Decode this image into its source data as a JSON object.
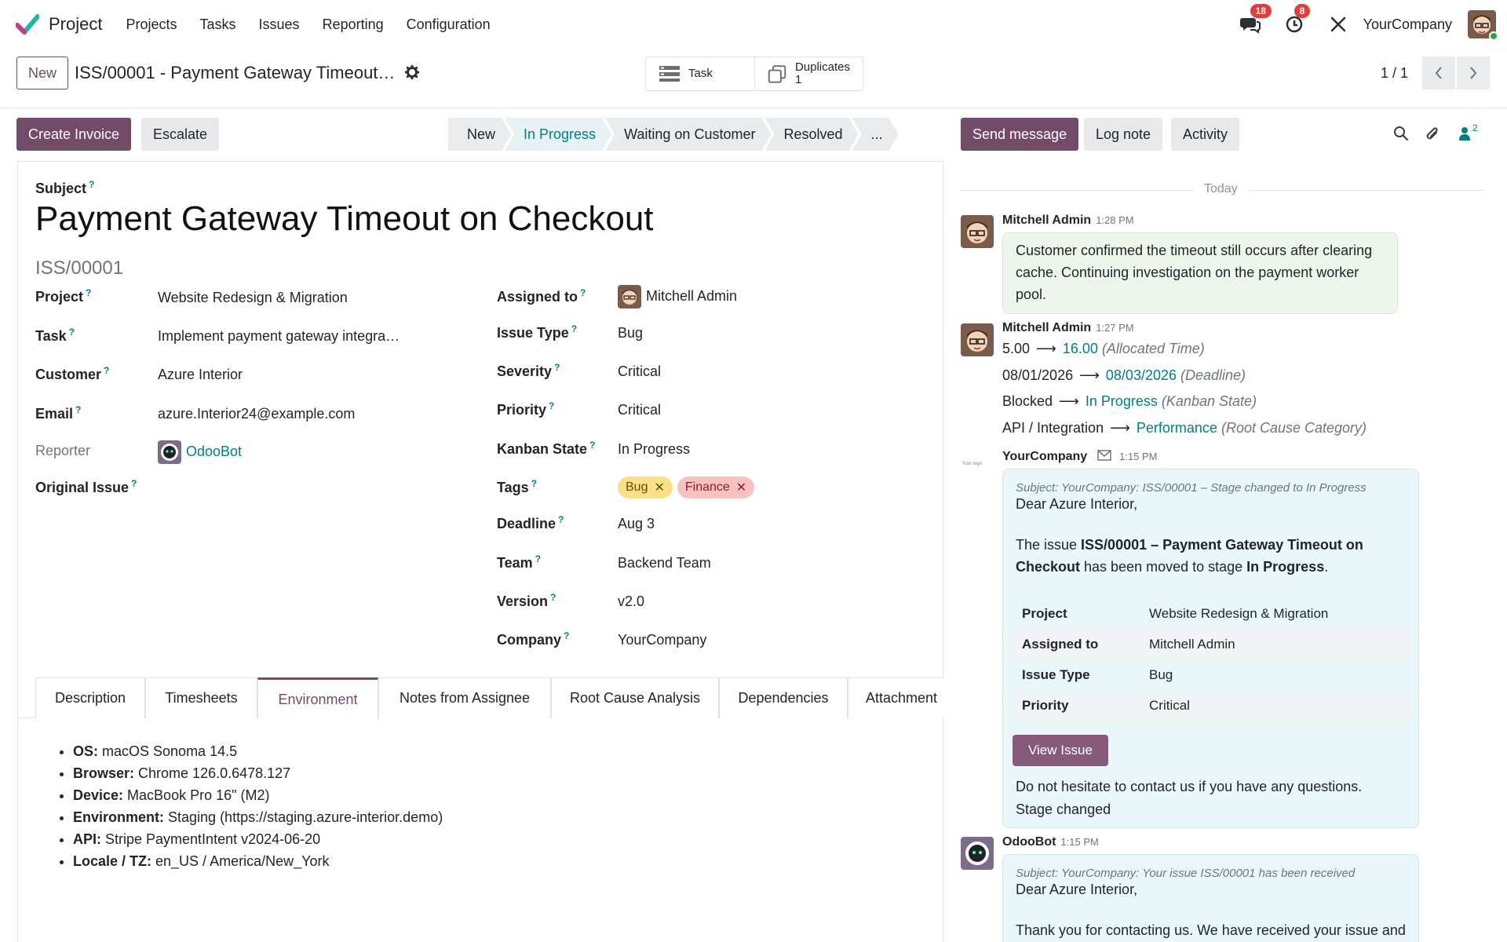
{
  "app": {
    "name": "Project",
    "menu": [
      "Projects",
      "Tasks",
      "Issues",
      "Reporting",
      "Configuration"
    ],
    "company": "YourCompany",
    "messages_count": "18",
    "activities_count": "8"
  },
  "control": {
    "new_label": "New",
    "record_name": "ISS/00001 - Payment Gateway Timeout…",
    "smart_task_label": "Task",
    "smart_duplicates_label": "Duplicates",
    "smart_duplicates_count": "1",
    "pager": "1 / 1"
  },
  "actions": {
    "create_invoice": "Create Invoice",
    "escalate": "Escalate"
  },
  "stages": [
    "New",
    "In Progress",
    "Waiting on Customer",
    "Resolved",
    "..."
  ],
  "active_stage": "In Progress",
  "form": {
    "subject_label": "Subject",
    "title": "Payment Gateway Timeout on Checkout",
    "reference": "ISS/00001",
    "left_fields": [
      {
        "label": "Project",
        "value": "Website Redesign & Migration"
      },
      {
        "label": "Task",
        "value": "Implement payment gateway integra…"
      },
      {
        "label": "Customer",
        "value": "Azure Interior"
      },
      {
        "label": "Email",
        "value": "azure.Interior24@example.com"
      },
      {
        "label": "Reporter",
        "value": "OdooBot"
      },
      {
        "label": "Original Issue",
        "value": ""
      }
    ],
    "right_fields": [
      {
        "label": "Assigned to",
        "value": "Mitchell Admin"
      },
      {
        "label": "Issue Type",
        "value": "Bug"
      },
      {
        "label": "Severity",
        "value": "Critical"
      },
      {
        "label": "Priority",
        "value": "Critical"
      },
      {
        "label": "Kanban State",
        "value": "In Progress"
      },
      {
        "label": "Tags",
        "value": ""
      },
      {
        "label": "Deadline",
        "value": "Aug 3"
      },
      {
        "label": "Team",
        "value": "Backend Team"
      },
      {
        "label": "Version",
        "value": "v2.0"
      },
      {
        "label": "Company",
        "value": "YourCompany"
      }
    ],
    "tags": [
      {
        "name": "Bug",
        "color": "#fbe08a"
      },
      {
        "name": "Finance",
        "color": "#f9c2c2"
      }
    ],
    "help_mark": "?",
    "tag_remove": "✕"
  },
  "tabs": [
    "Description",
    "Timesheets",
    "Environment",
    "Notes from Assignee",
    "Root Cause Analysis",
    "Dependencies",
    "Attachment"
  ],
  "active_tab": "Environment",
  "environment": [
    {
      "key": "OS:",
      "value": " macOS Sonoma 14.5"
    },
    {
      "key": "Browser:",
      "value": " Chrome 126.0.6478.127"
    },
    {
      "key": "Device:",
      "value": " MacBook Pro 16\" (M2)"
    },
    {
      "key": "Environment:",
      "value": " Staging (https://staging.azure-interior.demo)"
    },
    {
      "key": "API:",
      "value": " Stripe PaymentIntent v2024-06-20"
    },
    {
      "key": "Locale / TZ:",
      "value": " en_US / America/New_York"
    }
  ],
  "chatter": {
    "send_message": "Send message",
    "log_note": "Log note",
    "activity": "Activity",
    "followers_count": "2",
    "date_separator": "Today",
    "messages": [
      {
        "author": "Mitchell Admin",
        "time": "1:28 PM",
        "body": "Customer confirmed the timeout still occurs after clearing cache. Continuing investigation on the payment worker pool."
      },
      {
        "author": "Mitchell Admin",
        "time": "1:27 PM",
        "tracking": [
          {
            "old": "5.00",
            "new": "16.00",
            "field": "(Allocated Time)"
          },
          {
            "old": "08/01/2026",
            "new": "08/03/2026",
            "field": "(Deadline)"
          },
          {
            "old": "Blocked",
            "new": "In Progress",
            "field": "(Kanban State)"
          },
          {
            "old": "API / Integration",
            "new": "Performance",
            "field": "(Root Cause Category)"
          }
        ],
        "arrow": "⟶"
      },
      {
        "author": "YourCompany",
        "time": "1:15 PM",
        "logo_text": "Your logo",
        "subject": "Subject: YourCompany: ISS/00001 – Stage changed to In Progress",
        "greeting": "Dear Azure Interior,",
        "body_pre": "The issue ",
        "body_bold": "ISS/00001 – Payment Gateway Timeout on Checkout",
        "body_mid": " has been moved to stage ",
        "body_stage": "In Progress",
        "body_end": ".",
        "table": [
          {
            "k": "Project",
            "v": "Website Redesign & Migration"
          },
          {
            "k": "Assigned to",
            "v": "Mitchell Admin"
          },
          {
            "k": "Issue Type",
            "v": "Bug"
          },
          {
            "k": "Priority",
            "v": "Critical"
          }
        ],
        "button": "View Issue",
        "closing": "Do not hesitate to contact us if you have any questions.",
        "footer": "Stage changed"
      },
      {
        "author": "OdooBot",
        "time": "1:15 PM",
        "subject": "Subject: YourCompany: Your issue ISS/00001 has been received",
        "greeting": "Dear Azure Interior,",
        "body": "Thank you for contacting us. We have received your issue and"
      }
    ]
  },
  "colors": {
    "brand": "#714b67",
    "link": "#017e84",
    "badge": "#e23d3d"
  }
}
